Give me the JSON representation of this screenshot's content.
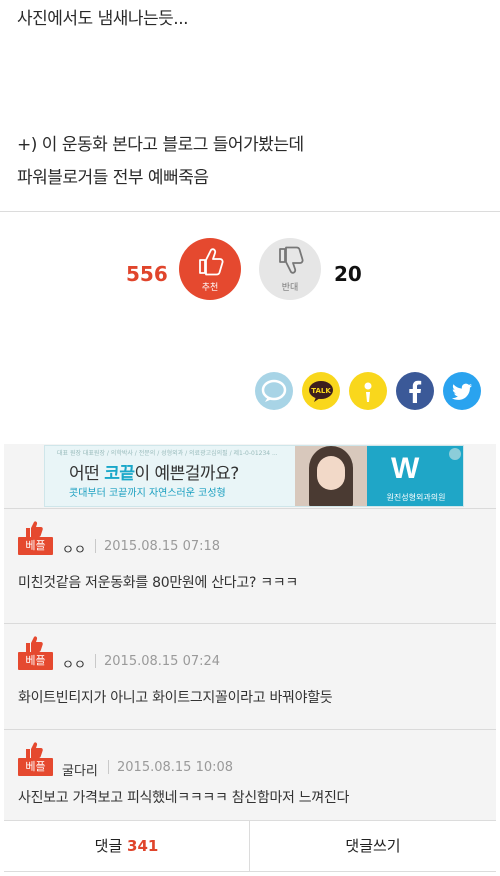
{
  "post": {
    "lines": [
      "사진에서도 냄새나는듯...",
      "+) 이 운동화 본다고 블로그 들어가봤는데",
      "파워블로거들 전부 예뻐죽음"
    ]
  },
  "vote": {
    "up_count": "556",
    "up_label": "추천",
    "down_label": "반대",
    "down_count": "20",
    "up_color": "#e5492f",
    "down_color": "#e6e6e6"
  },
  "share": {
    "icons": [
      "speech-bubble-icon",
      "kakaotalk-icon",
      "kakaostory-icon",
      "facebook-icon",
      "twitter-icon"
    ],
    "talk_label": "TALK",
    "colors": [
      "#a8d4e6",
      "#f9d71c",
      "#f9d71c",
      "#3b5998",
      "#2aa3ef"
    ]
  },
  "ad": {
    "small_text": "대표 원장 대표원장 / 의학박사 / 전문의 / 성형외과 / 의료광고심의필 / 제1-0-01234 ...",
    "headline_pre": "어떤 ",
    "headline_highlight": "코끝",
    "headline_post": "이 예쁜걸까요?",
    "sub": "콧대부터 코끝까지 자연스러운 코성형",
    "logo": "W",
    "clinic": "원진성형외과의원"
  },
  "comments": [
    {
      "badge": "베플",
      "author": "ㅇㅇ",
      "date": "2015.08.15 07:18",
      "text": "미친것같음 저운동화를 80만원에 산다고? ㅋㅋㅋ"
    },
    {
      "badge": "베플",
      "author": "ㅇㅇ",
      "date": "2015.08.15 07:24",
      "text": "화이트빈티지가 아니고 화이트그지꼴이라고 바꿔야할듯"
    },
    {
      "badge": "베플",
      "author": "굴다리",
      "date": "2015.08.15 10:08",
      "text": "사진보고 가격보고 피식했네ㅋㅋㅋㅋ 참신함마저 느껴진다"
    }
  ],
  "bottom": {
    "comments_label": "댓글",
    "comments_count": "341",
    "write_label": "댓글쓰기"
  }
}
